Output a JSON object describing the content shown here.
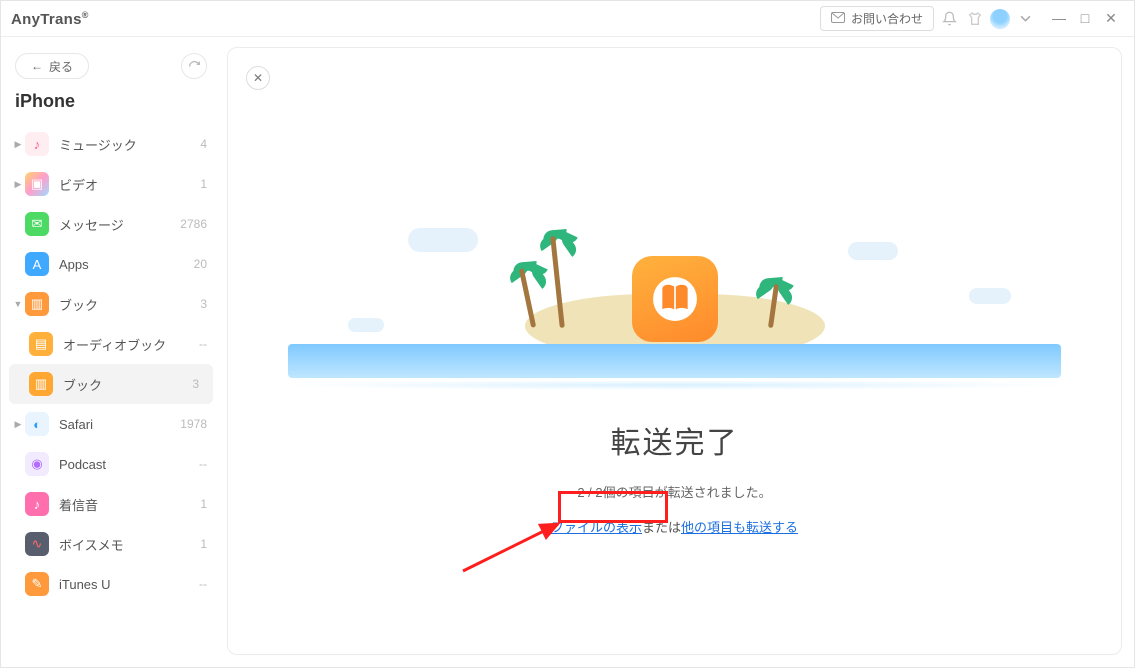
{
  "titlebar": {
    "app_name": "AnyTrans",
    "reg_mark": "®",
    "contact_label": "お問い合わせ"
  },
  "sidebar": {
    "back_label": "戻る",
    "device_name": "iPhone",
    "items": [
      {
        "label": "ミュージック",
        "count": "4",
        "caret": "▶",
        "icon": "music"
      },
      {
        "label": "ビデオ",
        "count": "1",
        "caret": "▶",
        "icon": "video"
      },
      {
        "label": "メッセージ",
        "count": "2786",
        "caret": "",
        "icon": "message"
      },
      {
        "label": "Apps",
        "count": "20",
        "caret": "",
        "icon": "apps"
      },
      {
        "label": "ブック",
        "count": "3",
        "caret": "▼",
        "icon": "books"
      },
      {
        "label": "オーディオブック",
        "count": "--",
        "caret": "",
        "icon": "audio",
        "child": true
      },
      {
        "label": "ブック",
        "count": "3",
        "caret": "",
        "icon": "book2",
        "child": true,
        "selected": true
      },
      {
        "label": "Safari",
        "count": "1978",
        "caret": "▶",
        "icon": "safari"
      },
      {
        "label": "Podcast",
        "count": "--",
        "caret": "",
        "icon": "podcast"
      },
      {
        "label": "着信音",
        "count": "1",
        "caret": "",
        "icon": "ring"
      },
      {
        "label": "ボイスメモ",
        "count": "1",
        "caret": "",
        "icon": "voice"
      },
      {
        "label": "iTunes U",
        "count": "--",
        "caret": "",
        "icon": "itunesu"
      }
    ]
  },
  "result": {
    "title": "転送完了",
    "subtitle": "2 / 2個の項目が転送されました。",
    "link_show_file": "ファイルの表示",
    "mid_text": "または",
    "link_transfer_more": "他の項目も転送する"
  }
}
